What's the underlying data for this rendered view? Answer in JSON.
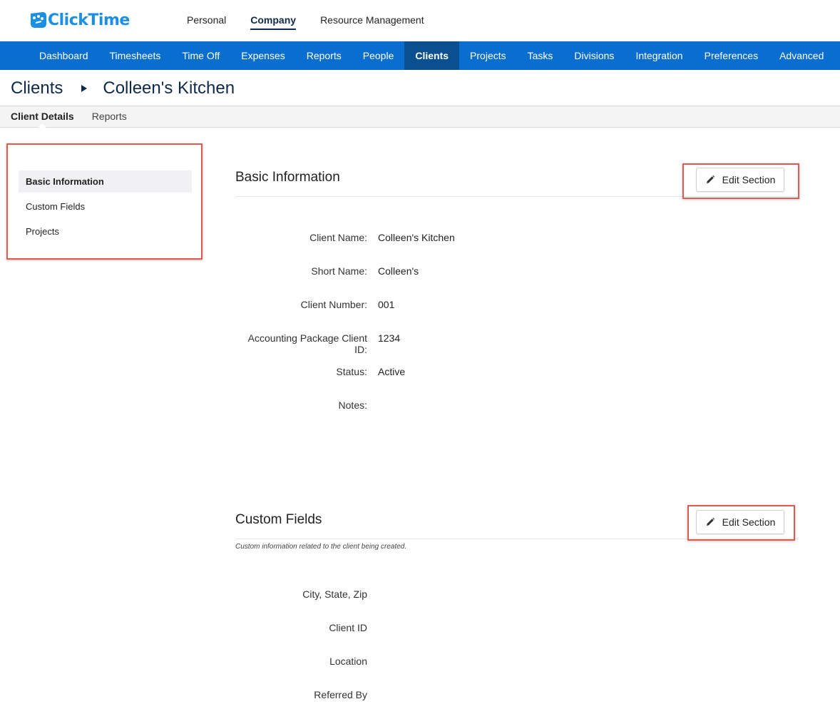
{
  "app": {
    "brand": "ClickTime",
    "brand_color": "#1a8fe3",
    "nav_color": "#0a6ed1",
    "nav_active_color": "#0a4f8f",
    "highlight_color": "#e05a52"
  },
  "topnav": {
    "personal": "Personal",
    "company": "Company",
    "resource": "Resource Management"
  },
  "mainnav": {
    "dashboard": "Dashboard",
    "timesheets": "Timesheets",
    "timeoff": "Time Off",
    "expenses": "Expenses",
    "reports": "Reports",
    "people": "People",
    "clients": "Clients",
    "projects": "Projects",
    "tasks": "Tasks",
    "divisions": "Divisions",
    "integration": "Integration",
    "preferences": "Preferences",
    "advanced": "Advanced"
  },
  "breadcrumb": {
    "root": "Clients",
    "current": "Colleen's Kitchen"
  },
  "subtabs": {
    "details": "Client Details",
    "reports": "Reports"
  },
  "sidemenu": {
    "basic": "Basic Information",
    "custom": "Custom Fields",
    "projects": "Projects"
  },
  "basic": {
    "title": "Basic Information",
    "edit_label": "Edit Section",
    "fields": {
      "client_name": {
        "label": "Client Name:",
        "value": "Colleen's Kitchen"
      },
      "short_name": {
        "label": "Short Name:",
        "value": "Colleen's"
      },
      "client_number": {
        "label": "Client Number:",
        "value": "001"
      },
      "accounting_id": {
        "label": "Accounting Package Client ID:",
        "value": "1234"
      },
      "status": {
        "label": "Status:",
        "value": "Active"
      },
      "notes": {
        "label": "Notes:",
        "value": ""
      }
    }
  },
  "custom": {
    "title": "Custom Fields",
    "edit_label": "Edit Section",
    "description": "Custom information related to the client being created.",
    "fields": {
      "city_state_zip": {
        "label": "City, State, Zip",
        "value": ""
      },
      "client_id": {
        "label": "Client ID",
        "value": ""
      },
      "location": {
        "label": "Location",
        "value": ""
      },
      "referred_by": {
        "label": "Referred By",
        "value": ""
      }
    }
  }
}
